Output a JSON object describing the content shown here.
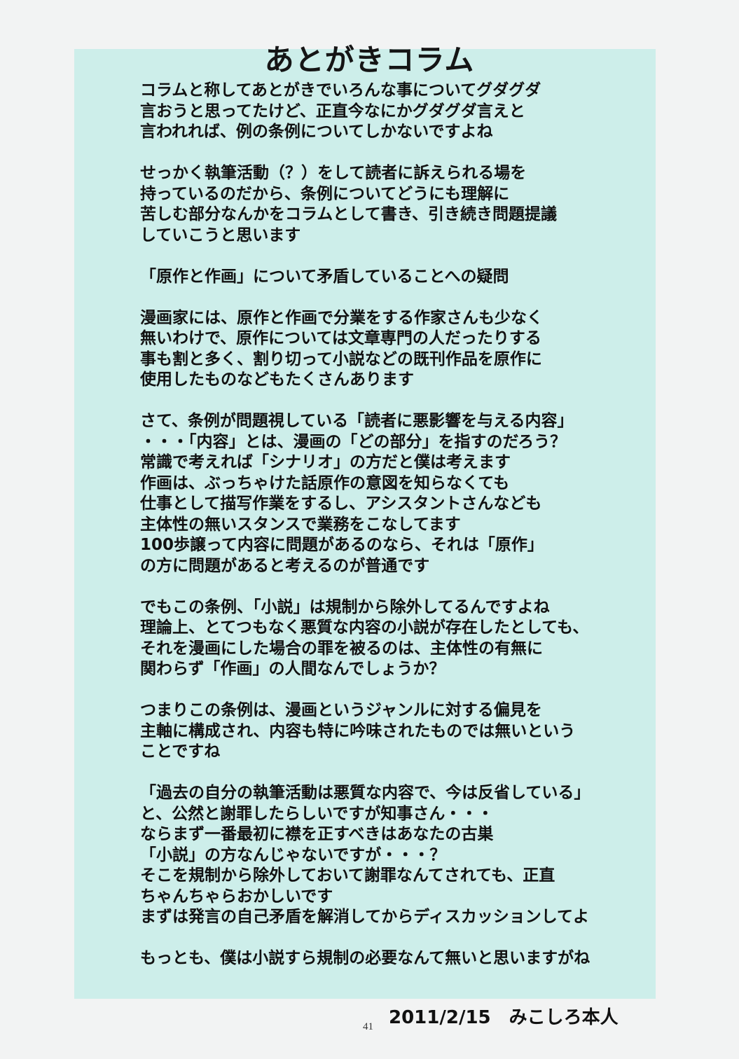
{
  "title": "あとがきコラム",
  "paragraphs": [
    [
      "コラムと称してあとがきでいろんな事についてグダグダ",
      "言おうと思ってたけど、正直今なにかグダグダ言えと",
      "言われれば、例の条例についてしかないですよね"
    ],
    [
      "せっかく執筆活動（？）をして読者に訴えられる場を",
      "持っているのだから、条例についてどうにも理解に",
      "苦しむ部分なんかをコラムとして書き、引き続き問題提議",
      "していこうと思います"
    ],
    [
      "「原作と作画」について矛盾していることへの疑問"
    ],
    [
      "漫画家には、原作と作画で分業をする作家さんも少なく",
      "無いわけで、原作については文章専門の人だったりする",
      "事も割と多く、割り切って小説などの既刊作品を原作に",
      "使用したものなどもたくさんあります"
    ],
    [
      "さて、条例が問題視している「読者に悪影響を与える内容」",
      "・・・「内容」とは、漫画の「どの部分」を指すのだろう？",
      "常識で考えれば「シナリオ」の方だと僕は考えます",
      "作画は、ぶっちゃけた話原作の意図を知らなくても",
      "仕事として描写作業をするし、アシスタントさんなども",
      "主体性の無いスタンスで業務をこなしてます",
      "100歩譲って内容に問題があるのなら、それは「原作」",
      "の方に問題があると考えるのが普通です"
    ],
    [
      "でもこの条例、「小説」は規制から除外してるんですよね",
      "理論上、とてつもなく悪質な内容の小説が存在したとしても、",
      "それを漫画にした場合の罪を被るのは、主体性の有無に",
      "関わらず「作画」の人間なんでしょうか？"
    ],
    [
      "つまりこの条例は、漫画というジャンルに対する偏見を",
      "主軸に構成され、内容も特に吟味されたものでは無いという",
      "ことですね"
    ],
    [
      "「過去の自分の執筆活動は悪質な内容で、今は反省している」",
      "と、公然と謝罪したらしいですが知事さん・・・",
      "ならまず一番最初に襟を正すべきはあなたの古巣",
      "「小説」の方なんじゃないですが・・・？",
      "そこを規制から除外しておいて謝罪なんてされても、正直",
      "ちゃんちゃらおかしいです",
      "まずは発言の自己矛盾を解消してからディスカッションしてよ"
    ],
    [
      "もっとも、僕は小説すら規制の必要なんて無いと思いますがね"
    ]
  ],
  "signature": "2011/2/15　みこしろ本人",
  "page_number": "41"
}
